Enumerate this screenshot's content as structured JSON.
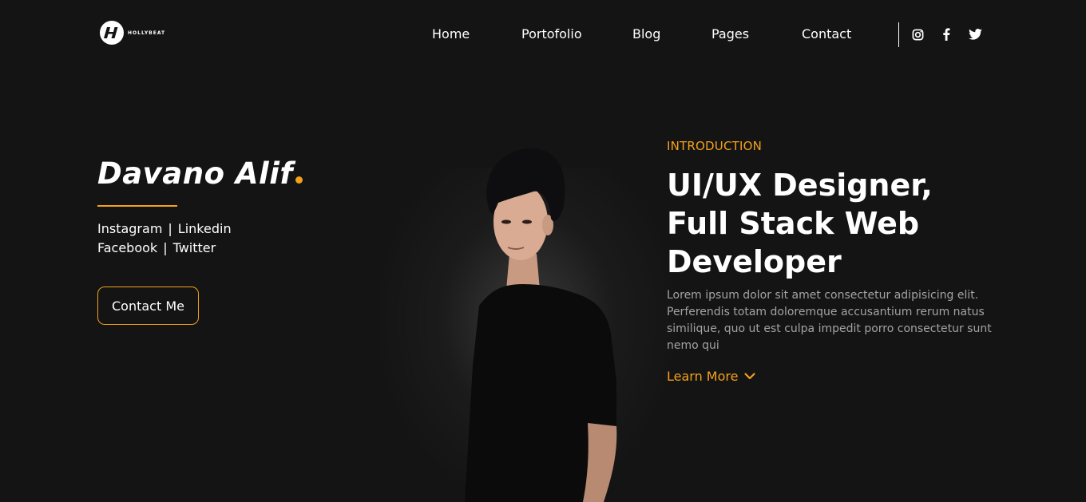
{
  "brand": {
    "logo_text": "HOLLYBEAT"
  },
  "nav": {
    "items": [
      {
        "label": "Home"
      },
      {
        "label": "Portofolio"
      },
      {
        "label": "Blog"
      },
      {
        "label": "Pages"
      },
      {
        "label": "Contact"
      }
    ],
    "social_icons": [
      "instagram-icon",
      "facebook-icon",
      "twitter-icon"
    ]
  },
  "hero_left": {
    "name": "Davano Alif",
    "links_row1": [
      "Instagram",
      "Linkedin"
    ],
    "links_row2": [
      "Facebook",
      "Twitter"
    ],
    "separator": "|",
    "contact_button": "Contact Me"
  },
  "hero_right": {
    "intro_label": "INTRODUCTION",
    "headline": "UI/UX Designer, Full Stack Web Developer",
    "description": "Lorem ipsum dolor sit amet consectetur adipisicing elit. Perferendis totam doloremque accusantium rerum natus similique, quo ut est culpa impedit porro consectetur sunt nemo qui",
    "learn_more": "Learn More"
  },
  "colors": {
    "background": "#141414",
    "accent": "#f4a11a",
    "text": "#ffffff",
    "muted": "#a3a3a3"
  }
}
